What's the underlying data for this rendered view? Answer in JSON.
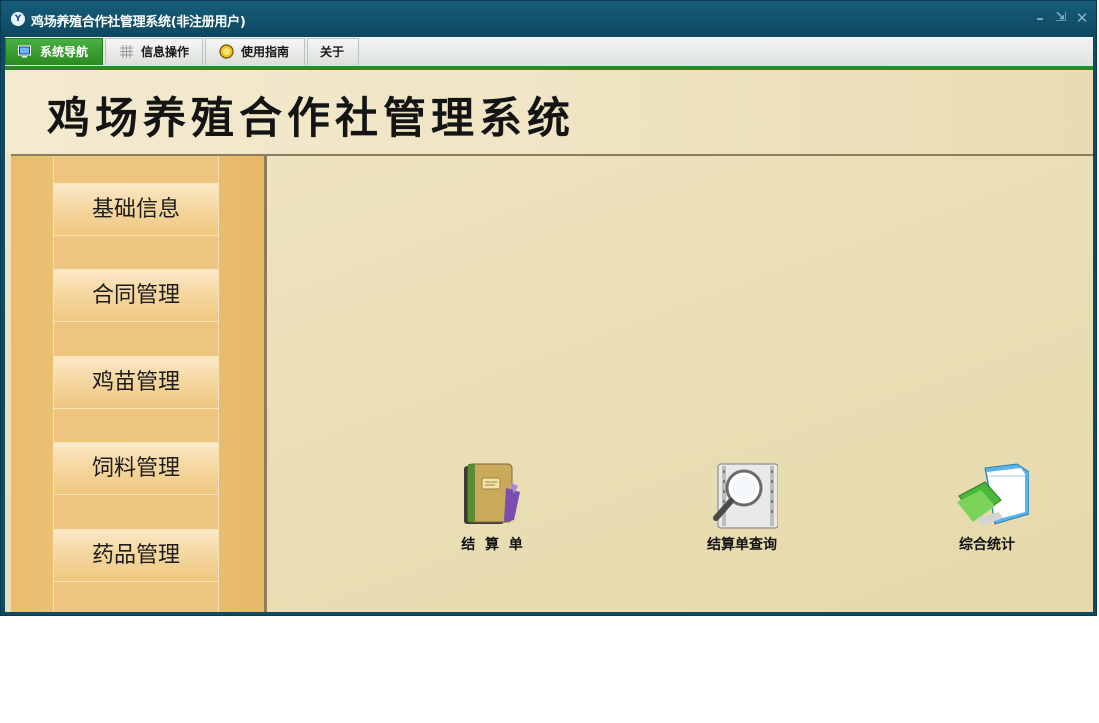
{
  "window": {
    "title": "鸡场养殖合作社管理系统(非注册用户)",
    "app_icon": "app-logo-icon",
    "controls": [
      "minimize-icon",
      "restore-icon",
      "close-icon"
    ]
  },
  "menubar": {
    "tabs": [
      {
        "label": "系统导航",
        "icon": "monitor-icon",
        "active": true
      },
      {
        "label": "信息操作",
        "icon": "grid-icon",
        "active": false
      },
      {
        "label": "使用指南",
        "icon": "help-coin-icon",
        "active": false
      },
      {
        "label": "关于",
        "icon": "",
        "active": false
      }
    ]
  },
  "header": {
    "title": "鸡场养殖合作社管理系统"
  },
  "sidebar": {
    "items": [
      {
        "label": "基础信息"
      },
      {
        "label": "合同管理"
      },
      {
        "label": "鸡苗管理"
      },
      {
        "label": "饲料管理"
      },
      {
        "label": "药品管理"
      }
    ]
  },
  "functions": [
    {
      "label": "结  算  单",
      "icon": "notebook-icon"
    },
    {
      "label": "结算单查询",
      "icon": "magnifier-film-icon"
    },
    {
      "label": "综合统计",
      "icon": "folder-report-icon"
    }
  ],
  "colors": {
    "titlebar": "#0f4a63",
    "active_tab": "#2b8a21",
    "sidebar": "#edc57d",
    "content": "#ece0b9"
  }
}
